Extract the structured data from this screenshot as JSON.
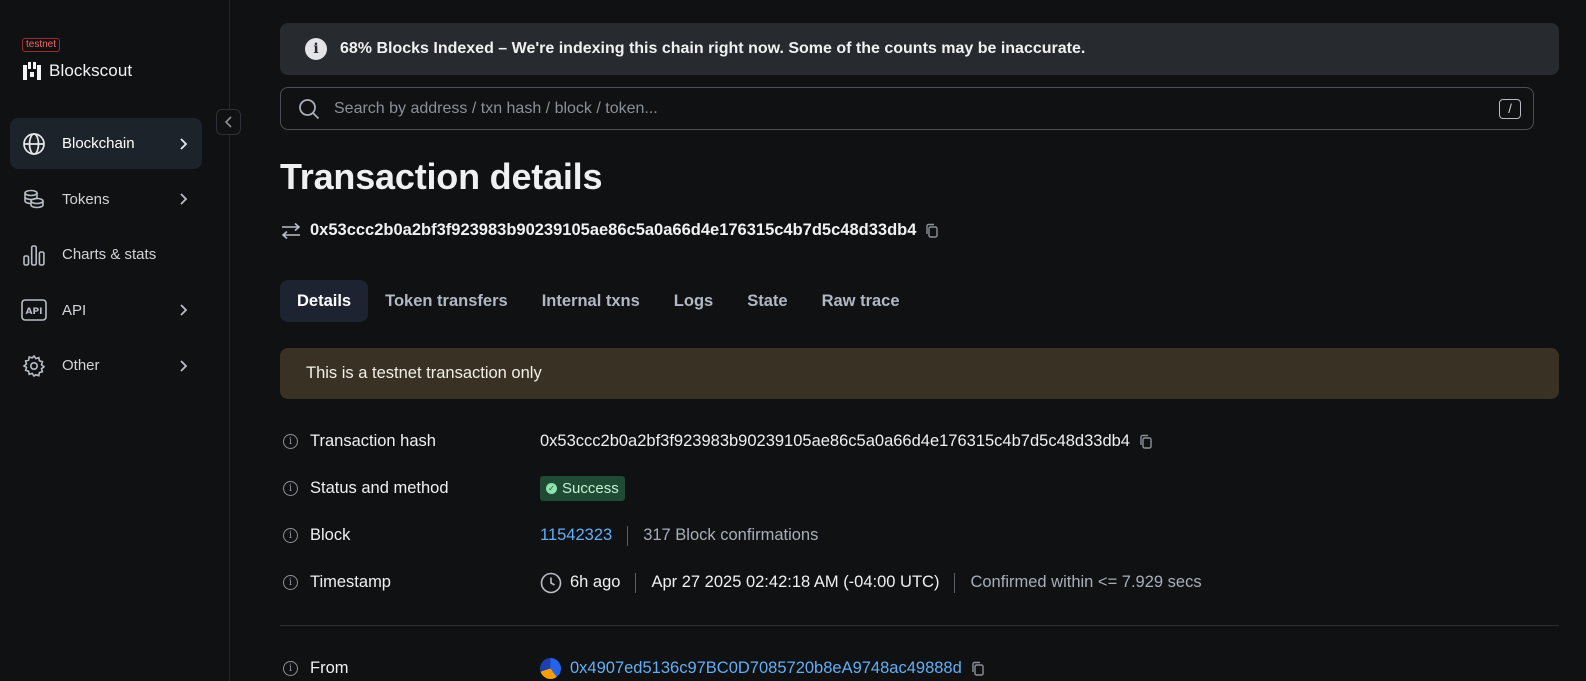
{
  "sidebar": {
    "env_badge": "testnet",
    "brand_name": "Blockscout",
    "items": [
      {
        "label": "Blockchain",
        "icon": "globe-icon",
        "active": true,
        "has_chevron": true
      },
      {
        "label": "Tokens",
        "icon": "coins-icon",
        "active": false,
        "has_chevron": true
      },
      {
        "label": "Charts & stats",
        "icon": "bar-chart-icon",
        "active": false,
        "has_chevron": false
      },
      {
        "label": "API",
        "icon": "api-icon",
        "active": false,
        "has_chevron": true
      },
      {
        "label": "Other",
        "icon": "gear-icon",
        "active": false,
        "has_chevron": true
      }
    ]
  },
  "alert": {
    "text": "68% Blocks Indexed – We're indexing this chain right now. Some of the counts may be inaccurate."
  },
  "search": {
    "placeholder": "Search by address / txn hash / block / token...",
    "shortcut": "/"
  },
  "page": {
    "title": "Transaction details",
    "tx_hash": "0x53ccc2b0a2bf3f923983b90239105ae86c5a0a66d4e176315c4b7d5c48d33db4"
  },
  "tabs": [
    "Details",
    "Token transfers",
    "Internal txns",
    "Logs",
    "State",
    "Raw trace"
  ],
  "testnet_banner": "This is a testnet transaction only",
  "details": {
    "tx_hash_label": "Transaction hash",
    "tx_hash_value": "0x53ccc2b0a2bf3f923983b90239105ae86c5a0a66d4e176315c4b7d5c48d33db4",
    "status_label": "Status and method",
    "status_value": "Success",
    "block_label": "Block",
    "block_number": "11542323",
    "block_confirmations": "317 Block confirmations",
    "timestamp_label": "Timestamp",
    "timestamp_relative": "6h ago",
    "timestamp_absolute": "Apr 27 2025 02:42:18 AM (-04:00 UTC)",
    "timestamp_confirmed": "Confirmed within <= 7.929 secs",
    "from_label": "From",
    "from_address": "0x4907ed5136c97BC0D7085720b8eA9748ac49888d"
  },
  "colors": {
    "background": "#101112",
    "accent_link": "#63aef5",
    "success_bg": "#1f4a33",
    "banner_bg": "#393123"
  }
}
